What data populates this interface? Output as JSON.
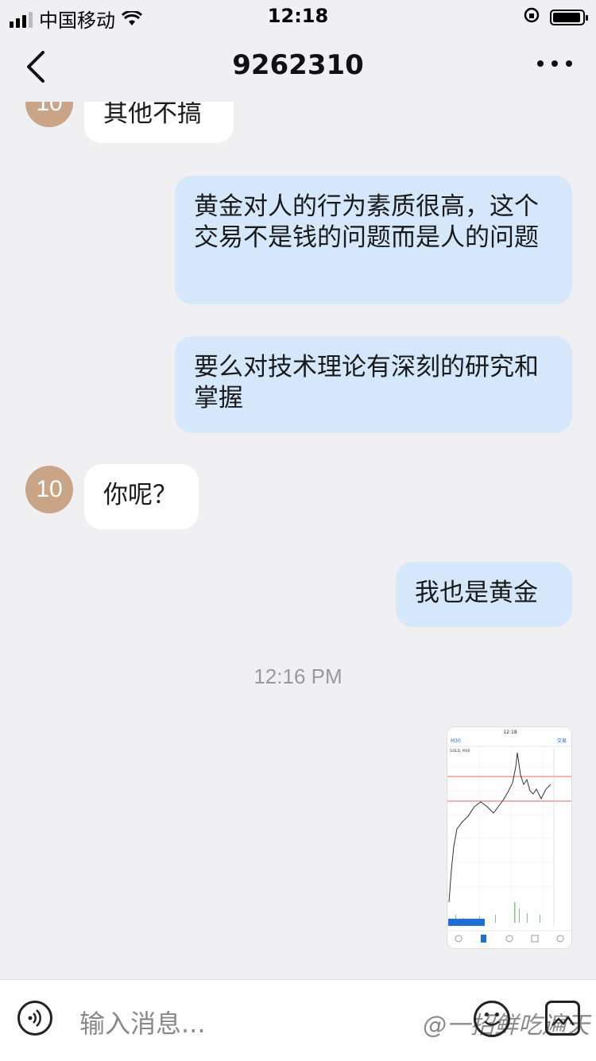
{
  "status": {
    "carrier": "中国移动",
    "time": "12:18"
  },
  "header": {
    "title": "9262310"
  },
  "messages": [
    {
      "side": "in",
      "avatar": "10",
      "text": "其他不搞"
    },
    {
      "side": "out",
      "text": "黄金对人的行为素质很高，这个交易不是钱的问题而是人的问题"
    },
    {
      "side": "out",
      "text": "要么对技术理论有深刻的研究和掌握"
    },
    {
      "side": "in",
      "avatar": "10",
      "text": "你呢？"
    },
    {
      "side": "out",
      "text": "我也是黄金"
    }
  ],
  "timestamp": "12:16 PM",
  "image_message": {
    "status_time": "12:18",
    "timeframe": "M30",
    "trade_label": "交易",
    "symbol": "GOLD, M30"
  },
  "input": {
    "placeholder": "输入消息..."
  },
  "watermark": "@一招鲜吃遍天"
}
